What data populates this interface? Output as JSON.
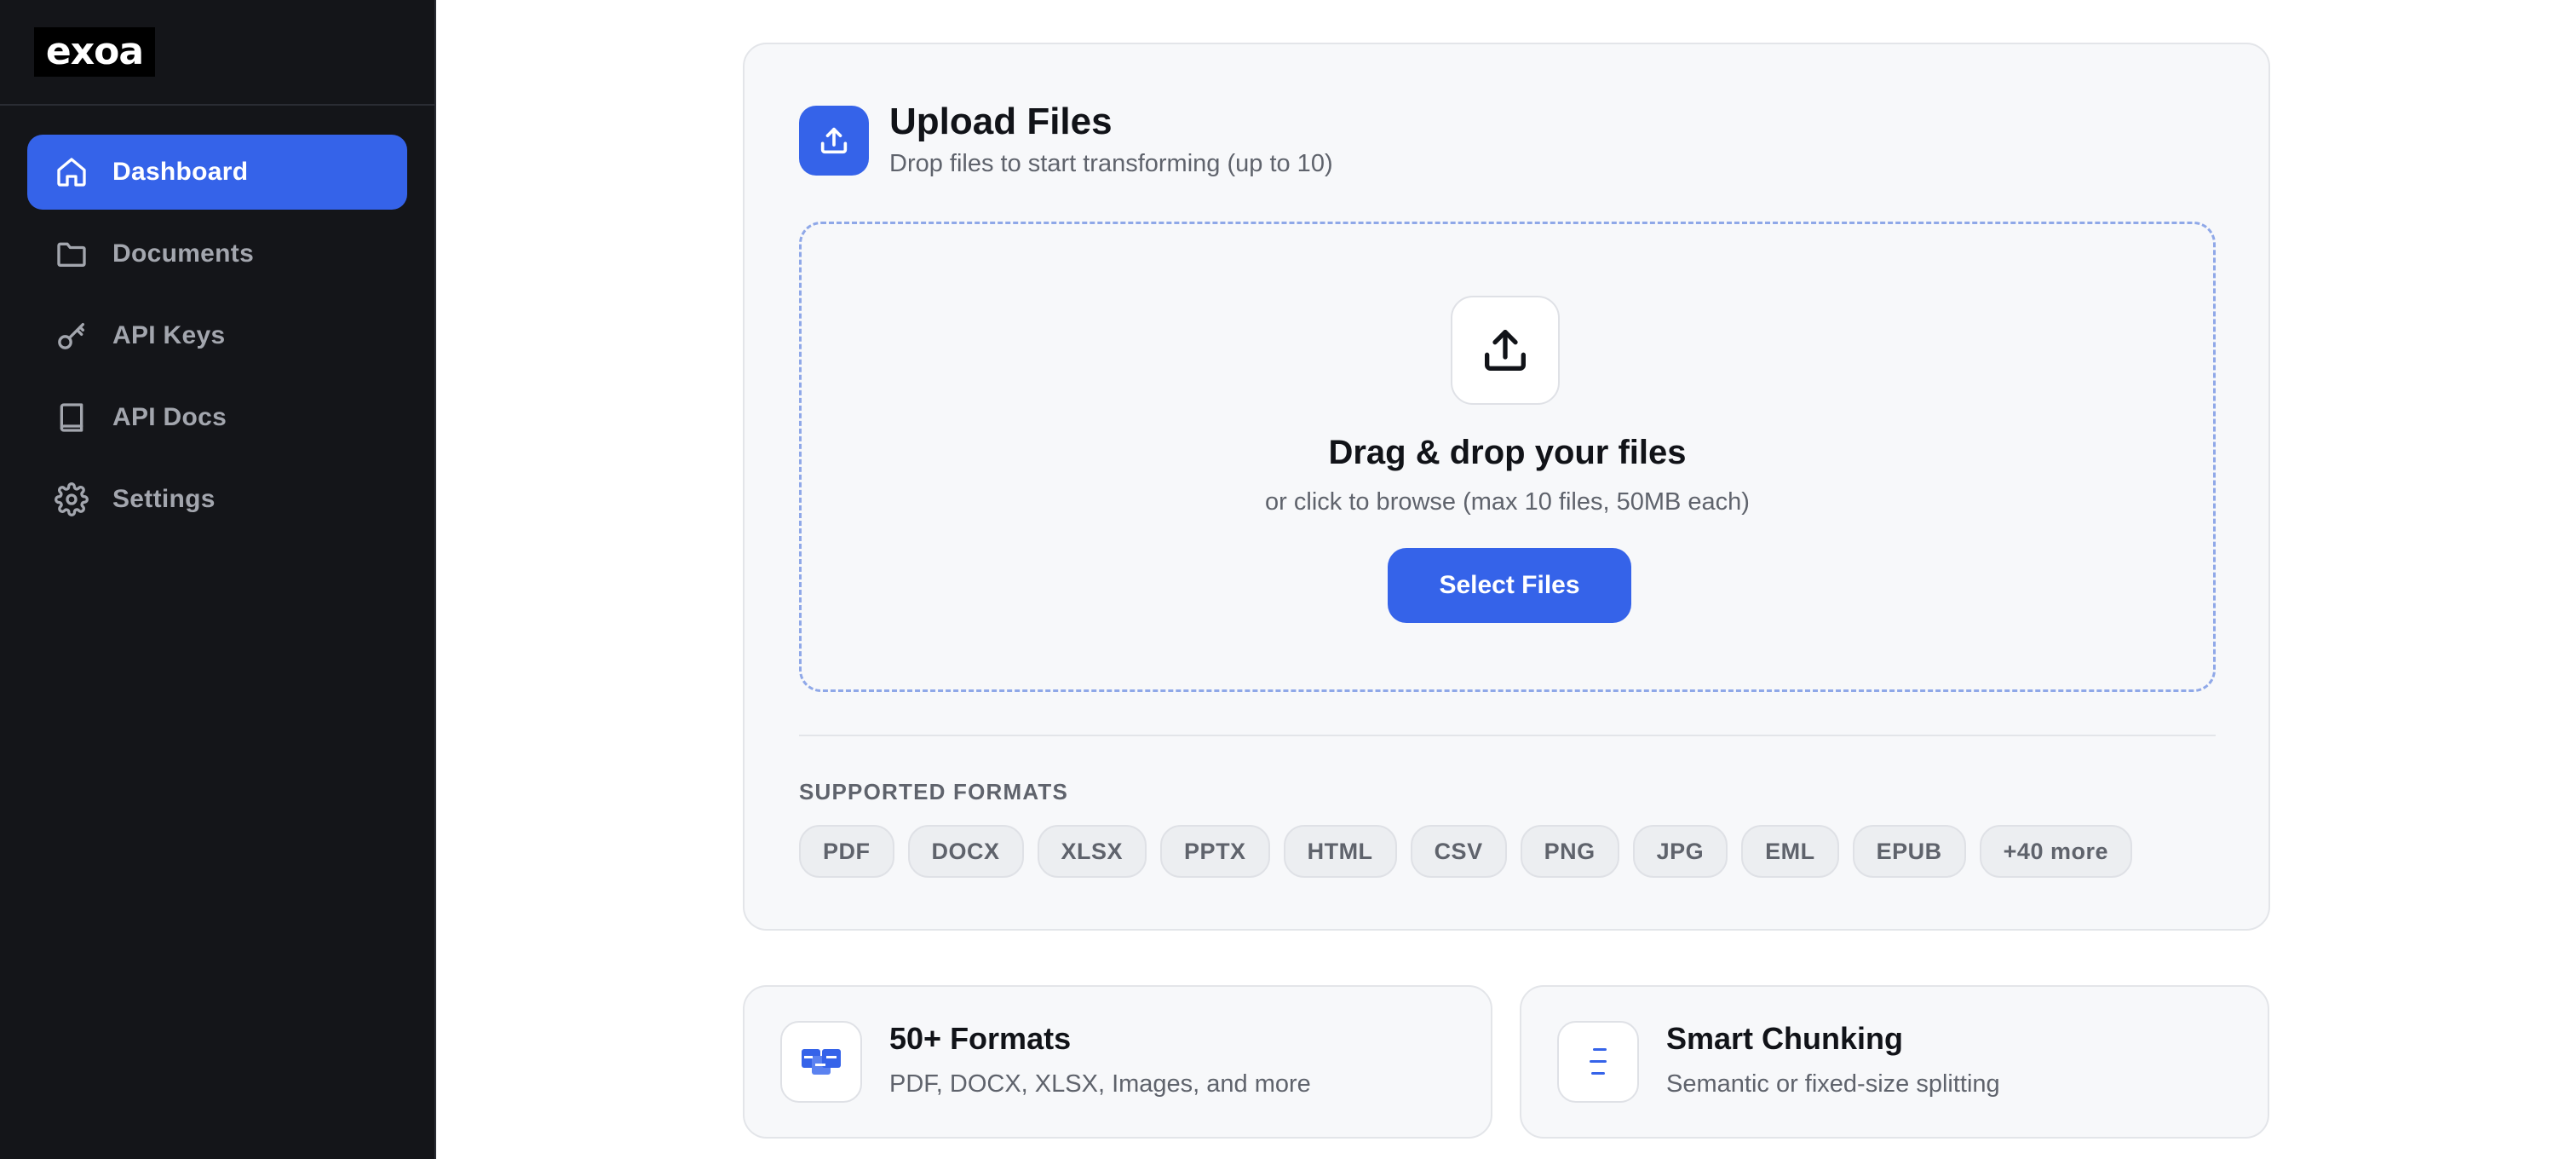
{
  "sidebar": {
    "logo": "exoa",
    "items": [
      {
        "label": "Dashboard",
        "icon": "home-icon",
        "active": true
      },
      {
        "label": "Documents",
        "icon": "folder-icon",
        "active": false
      },
      {
        "label": "API Keys",
        "icon": "key-icon",
        "active": false
      },
      {
        "label": "API Docs",
        "icon": "book-icon",
        "active": false
      },
      {
        "label": "Settings",
        "icon": "gear-icon",
        "active": false
      }
    ]
  },
  "upload": {
    "title": "Upload Files",
    "subtitle": "Drop files to start transforming (up to 10)",
    "dropzone": {
      "title": "Drag & drop your files",
      "subtitle": "or click to browse (max 10 files, 50MB each)",
      "button": "Select Files"
    },
    "formats_label": "SUPPORTED FORMATS",
    "formats": [
      "PDF",
      "DOCX",
      "XLSX",
      "PPTX",
      "HTML",
      "CSV",
      "PNG",
      "JPG",
      "EML",
      "EPUB",
      "+40 more"
    ]
  },
  "features": [
    {
      "title": "50+ Formats",
      "subtitle": "PDF, DOCX, XLSX, Images, and more",
      "icon": "formats-icon"
    },
    {
      "title": "Smart Chunking",
      "subtitle": "Semantic or fixed-size splitting",
      "icon": "chunking-icon"
    }
  ],
  "colors": {
    "accent": "#3563e9",
    "sidebar_bg": "#141519",
    "card_bg": "#f7f8fa"
  }
}
